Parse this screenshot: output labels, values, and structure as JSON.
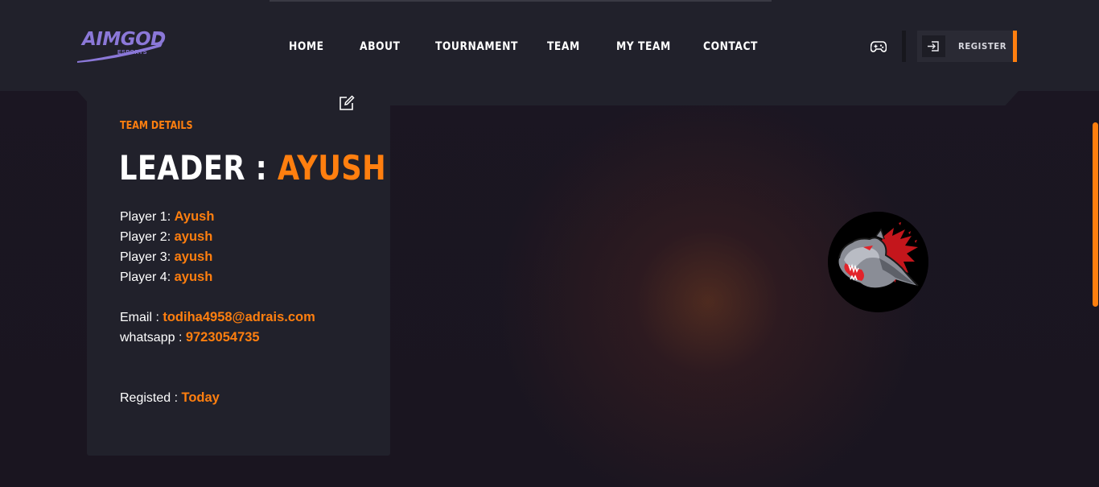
{
  "brand": {
    "name": "AIMGOD",
    "sub": "ESPORTS",
    "color": "#8b78d8"
  },
  "nav": {
    "items": [
      {
        "label": "HOME"
      },
      {
        "label": "ABOUT"
      },
      {
        "label": "TOURNAMENT"
      },
      {
        "label": "TEAM"
      },
      {
        "label": "MY TEAM"
      },
      {
        "label": "CONTACT"
      }
    ]
  },
  "header_actions": {
    "gamepad_icon": "gamepad-icon",
    "register_label": "REGISTER",
    "register_icon": "sign-in-icon"
  },
  "team_card": {
    "section_label": "TEAM DETAILS",
    "leader_prefix": "LEADER : ",
    "leader_name": "AYUSH",
    "players": [
      {
        "label": "Player 1: ",
        "name": "Ayush"
      },
      {
        "label": "Player 2: ",
        "name": "ayush"
      },
      {
        "label": "Player 3: ",
        "name": "ayush"
      },
      {
        "label": "Player 4: ",
        "name": "ayush"
      }
    ],
    "email_label": "Email : ",
    "email": "todiha4958@adrais.com",
    "whatsapp_label": "whatsapp : ",
    "whatsapp": "9723054735",
    "registered_label": "Registed : ",
    "registered": "Today",
    "edit_icon": "edit-icon"
  },
  "team_logo": {
    "icon": "panther-logo-icon"
  },
  "colors": {
    "accent": "#ff7f0f",
    "header_bg": "#21212b",
    "page_bg": "#1a1520",
    "card_bg": "#21212b"
  }
}
